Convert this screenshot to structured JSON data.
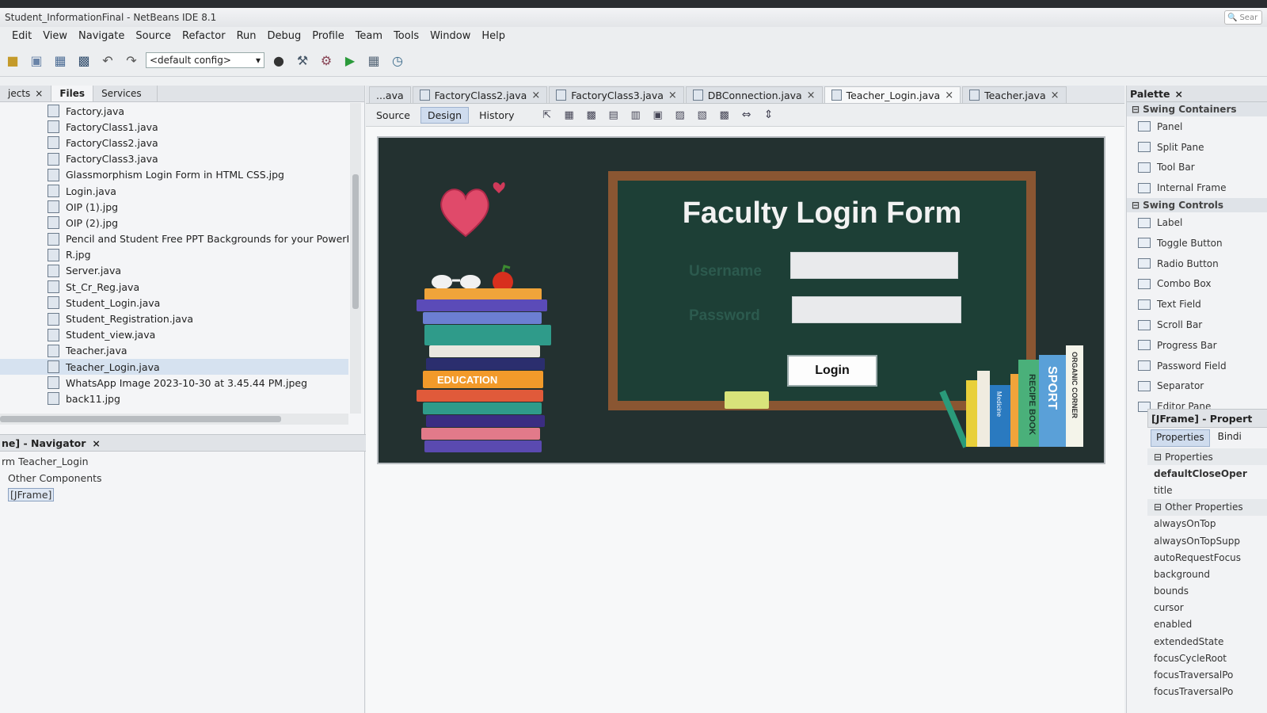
{
  "window": {
    "title": "Student_InformationFinal - NetBeans IDE 8.1",
    "search_placeholder": "Sear"
  },
  "menu": [
    "Edit",
    "View",
    "Navigate",
    "Source",
    "Refactor",
    "Run",
    "Debug",
    "Profile",
    "Team",
    "Tools",
    "Window",
    "Help"
  ],
  "toolbar": {
    "config": "<default config>"
  },
  "projects_panel": {
    "tabs": [
      "jects",
      "Files",
      "Services"
    ],
    "files": [
      "Factory.java",
      "FactoryClass1.java",
      "FactoryClass2.java",
      "FactoryClass3.java",
      "Glassmorphism Login Form in HTML  CSS.jpg",
      "Login.java",
      "OIP (1).jpg",
      "OIP (2).jpg",
      "Pencil and Student Free PPT Backgrounds for your PowerPoint T",
      "R.jpg",
      "Server.java",
      "St_Cr_Reg.java",
      "Student_Login.java",
      "Student_Registration.java",
      "Student_view.java",
      "Teacher.java",
      "Teacher_Login.java",
      "WhatsApp Image 2023-10-30 at 3.45.44 PM.jpeg",
      "back11.jpg"
    ],
    "selected_index": 16
  },
  "navigator": {
    "title": "ne] - Navigator",
    "items": [
      "rm Teacher_Login",
      "Other Components",
      "[JFrame]"
    ]
  },
  "editor": {
    "tabs": [
      "...ava",
      "FactoryClass2.java",
      "FactoryClass3.java",
      "DBConnection.java",
      "Teacher_Login.java",
      "Teacher.java"
    ],
    "active_tab": "Teacher_Login.java",
    "view_tabs": [
      "Source",
      "Design",
      "History"
    ],
    "active_view": "Design"
  },
  "form": {
    "title": "Faculty Login Form",
    "username_label": "Username",
    "password_label": "Password",
    "login_button": "Login",
    "education_label": "EDUCATION",
    "book_labels": [
      "RECIPE BOOK",
      "SPORT",
      "ORGANIC CORNER",
      "Medicine"
    ]
  },
  "palette": {
    "title": "Palette",
    "categories": [
      {
        "name": "Swing Containers",
        "items": [
          "Panel",
          "Split Pane",
          "Tool Bar",
          "Internal Frame"
        ]
      },
      {
        "name": "Swing Controls",
        "items": [
          "Label",
          "Toggle Button",
          "Radio Button",
          "Combo Box",
          "Text Field",
          "Scroll Bar",
          "Progress Bar",
          "Password Field",
          "Separator",
          "Editor Pane"
        ]
      }
    ]
  },
  "properties": {
    "title": "[JFrame] - Propert",
    "tabs": [
      "Properties",
      "Bindi"
    ],
    "sections": [
      "Properties",
      "Other Properties"
    ],
    "props_main": [
      "defaultCloseOper",
      "title"
    ],
    "props_other": [
      "alwaysOnTop",
      "alwaysOnTopSupp",
      "autoRequestFocus",
      "background",
      "bounds",
      "cursor",
      "enabled",
      "extendedState",
      "focusCycleRoot",
      "focusTraversalPo",
      "focusTraversalPo"
    ]
  }
}
